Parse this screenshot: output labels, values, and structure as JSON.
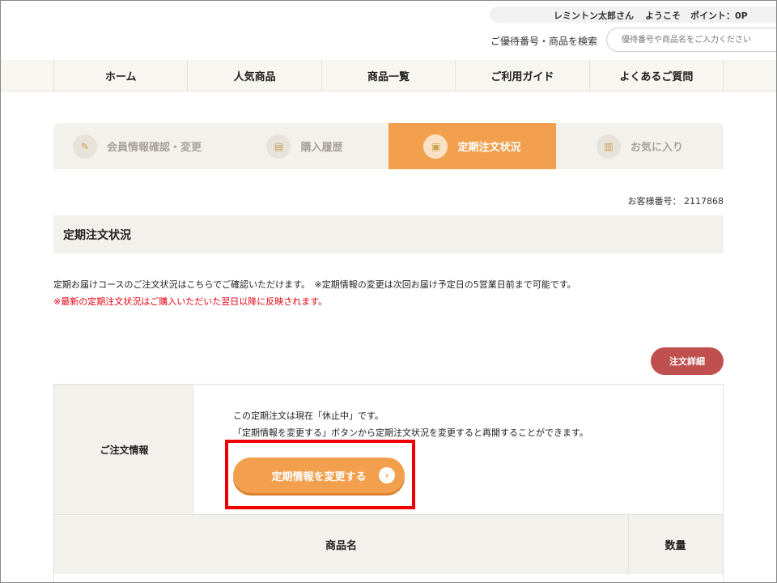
{
  "header": {
    "user_name": "レミントン太郎さん",
    "welcome": "ようこそ",
    "points": "ポイント：0P",
    "search_label": "ご優待番号・商品を検索",
    "search_placeholder": "優待番号や商品名をご入力ください"
  },
  "nav": {
    "items": [
      "ホーム",
      "人気商品",
      "商品一覧",
      "ご利用ガイド",
      "よくあるご質問"
    ]
  },
  "tabs": [
    {
      "label": "会員情報確認・変更",
      "icon": "edit-icon",
      "active": false
    },
    {
      "label": "購入履歴",
      "icon": "cart-icon",
      "active": false
    },
    {
      "label": "定期注文状況",
      "icon": "truck-icon",
      "active": true
    },
    {
      "label": "お気に入り",
      "icon": "favorite-icon",
      "active": false
    }
  ],
  "customer_number": "お客様番号： 2117868",
  "section_title": "定期注文状況",
  "description": "定期お届けコースのご注文状況はこちらでご確認いただけます。　※定期情報の変更は次回お届け予定日の5営業日前まで可能です。",
  "notice": "※最新の定期注文状況はご購入いただいた翌日以降に反映されます。",
  "detail_button": "注文詳細",
  "order_info": {
    "label": "ご注文情報",
    "status_text": "この定期注文は現在「休止中」です。",
    "resume_text": "「定期情報を変更する」ボタンから定期注文状況を変更すると再開することができます。",
    "change_button": "定期情報を変更する"
  },
  "table_headers": {
    "product_name": "商品名",
    "quantity": "数量"
  },
  "colors": {
    "accent": "#f2a04e",
    "detail_button": "#c0504f",
    "notice": "#e60012",
    "highlight_box": "#ee0000"
  }
}
